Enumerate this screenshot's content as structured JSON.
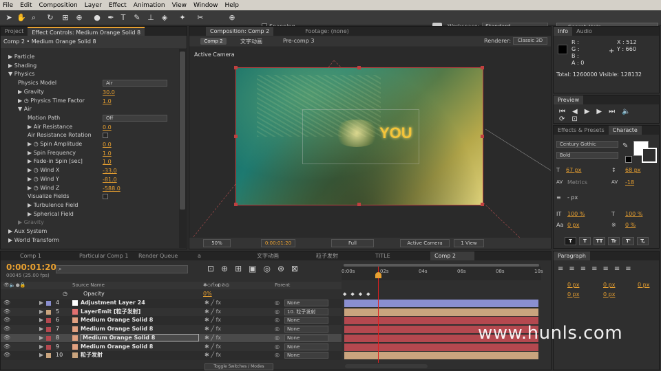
{
  "menu": [
    "File",
    "Edit",
    "Composition",
    "Layer",
    "Effect",
    "Animation",
    "View",
    "Window",
    "Help"
  ],
  "toolbar": {
    "snapping_label": "Snapping",
    "workspace_label": "Workspace:",
    "workspace_value": "Standard",
    "search_placeholder": "Search Help"
  },
  "left_panel": {
    "tab_project": "Project",
    "tab_effect_controls": "Effect Controls: Medium Orange Solid 8",
    "breadcrumb": "Comp 2 • Medium Orange Solid 8",
    "rows": [
      {
        "label": "▶ Particle",
        "indent": 1
      },
      {
        "label": "▶ Shading",
        "indent": 1
      },
      {
        "label": "▼ Physics",
        "indent": 1
      },
      {
        "label": "Physics Model",
        "indent": 3,
        "dropdown": "Air"
      },
      {
        "label": "▶ Gravity",
        "indent": 3,
        "value": "30.0"
      },
      {
        "label": "▶ ◷ Physics Time Factor",
        "indent": 3,
        "value": "1.0"
      },
      {
        "label": "▼ Air",
        "indent": 3
      },
      {
        "label": "Motion Path",
        "indent": 5,
        "dropdown": "Off"
      },
      {
        "label": "▶ Air Resistance",
        "indent": 5,
        "value": "0.0"
      },
      {
        "label": "Air Resistance Rotation",
        "indent": 5,
        "checkbox": true
      },
      {
        "label": "▶ ◷ Spin Amplitude",
        "indent": 5,
        "value": "0.0"
      },
      {
        "label": "▶ Spin Frequency",
        "indent": 5,
        "value": "1.0"
      },
      {
        "label": "▶ Fade-in Spin [sec]",
        "indent": 5,
        "value": "1.0"
      },
      {
        "label": "▶ ◷ Wind X",
        "indent": 5,
        "value": "-33.0"
      },
      {
        "label": "▶ ◷ Wind Y",
        "indent": 5,
        "value": "-81.0"
      },
      {
        "label": "▶ ◷ Wind Z",
        "indent": 5,
        "value": "-588.0"
      },
      {
        "label": "Visualize Fields",
        "indent": 5,
        "checkbox": true
      },
      {
        "label": "▶ Turbulence Field",
        "indent": 5
      },
      {
        "label": "▶ Spherical Field",
        "indent": 5
      },
      {
        "label": "▶ Gravity",
        "indent": 3,
        "dim": true
      },
      {
        "label": "▶ Aux System",
        "indent": 1
      },
      {
        "label": "▶ World Transform",
        "indent": 1
      }
    ]
  },
  "comp_panel": {
    "tab_comp": "Composition: Comp 2",
    "tab_footage": "Footage: (none)",
    "crumbs": [
      "Comp 2",
      "文字动画",
      "Pre-comp 3"
    ],
    "renderer_label": "Renderer:",
    "renderer_value": "Classic 3D",
    "active_camera": "Active Camera",
    "canvas_text": "YOU",
    "zoom": "50%",
    "timecode": "0:00:01:20",
    "resolution": "Full",
    "view": "Active Camera",
    "view_count": "1 View"
  },
  "info_panel": {
    "tab_info": "Info",
    "tab_audio": "Audio",
    "r": "R :",
    "g": "G :",
    "b": "B :",
    "a": "A : 0",
    "x": "X : 512",
    "y": "Y : 660",
    "total": "Total: 1260000   Visible: 128132"
  },
  "preview_panel": {
    "title": "Preview"
  },
  "effects_panel": {
    "tab_effects": "Effects & Presets",
    "tab_character": "Characte"
  },
  "character": {
    "font": "Century Gothic",
    "style": "Bold",
    "size": "67 px",
    "leading": "68 px",
    "kerning": "Metrics",
    "tracking": "-18",
    "stroke": "- px",
    "vscale": "100 %",
    "hscale": "100 %",
    "baseline": "0 px",
    "tsume": "0 %",
    "styles": [
      "T",
      "T",
      "TT",
      "Tr",
      "T'",
      "T,"
    ]
  },
  "paragraph": {
    "title": "Paragraph",
    "vals": [
      "0 px",
      "0 px",
      "0 px",
      "0 px",
      "0 px"
    ]
  },
  "timeline": {
    "tabs": [
      "Comp 1",
      "Particular Comp 1",
      "Render Queue",
      "a",
      "文字动画",
      "粒子发射",
      "TITLE",
      "Comp 2"
    ],
    "timecode": "0:00:01:20",
    "frames": "00045 (25.00 fps)",
    "col_source": "Source Name",
    "col_parent": "Parent",
    "opacity_label": "Opacity",
    "opacity_value": "0%",
    "ruler": [
      "0:00s",
      "02s",
      "04s",
      "06s",
      "08s",
      "10s"
    ],
    "layers": [
      {
        "num": "4",
        "name": "Adjustment Layer 24",
        "parent": "None",
        "color": "#8a8fd0",
        "swatch": "#ffffff"
      },
      {
        "num": "5",
        "name": "LayerEmit [粒子发射]",
        "parent": "10. 粒子发射",
        "color": "#c9a47e",
        "swatch": "#e07070"
      },
      {
        "num": "6",
        "name": "Medium Orange Solid 8",
        "parent": "None",
        "color": "#b4484f",
        "swatch": "#e0a080"
      },
      {
        "num": "7",
        "name": "Medium Orange Solid 8",
        "parent": "None",
        "color": "#b4484f",
        "swatch": "#e0a080"
      },
      {
        "num": "8",
        "name": "Medium Orange Solid 8",
        "parent": "None",
        "color": "#b4484f",
        "swatch": "#e0a080"
      },
      {
        "num": "9",
        "name": "Medium Orange Solid 8",
        "parent": "None",
        "color": "#b4484f",
        "swatch": "#e0a080"
      },
      {
        "num": "10",
        "name": "粒子发射",
        "parent": "None",
        "color": "#c9a47e",
        "swatch": "#c9a47e"
      }
    ],
    "toggle_label": "Toggle Switches / Modes"
  },
  "watermark": "www.hunls.com",
  "colors": {
    "accent": "#e8a030",
    "cti": "#e02020"
  }
}
